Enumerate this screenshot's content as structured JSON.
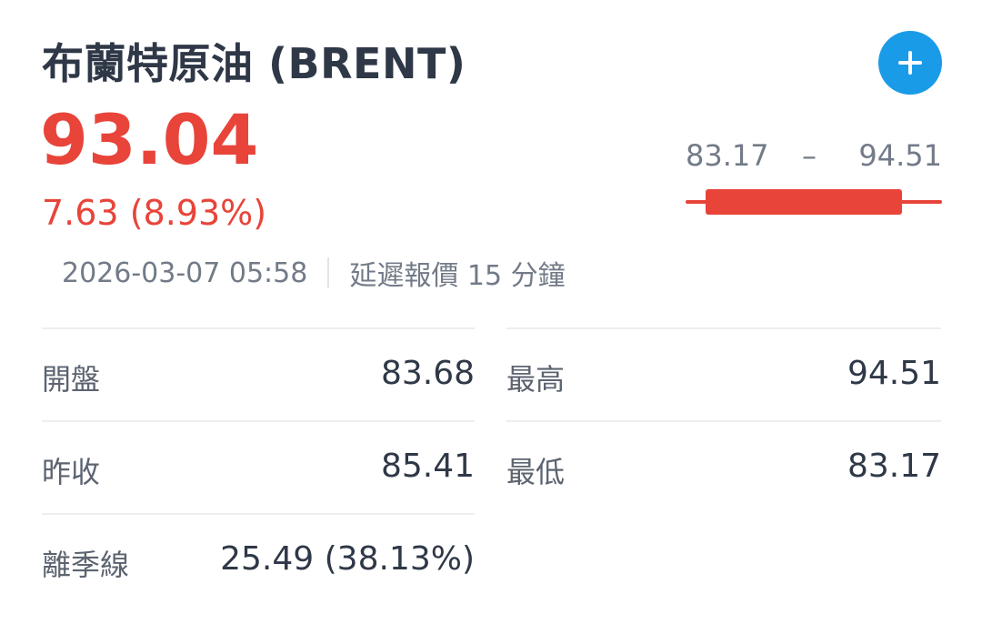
{
  "header": {
    "title": "布蘭特原油 (BRENT)",
    "add_icon": "plus-icon"
  },
  "quote": {
    "price": "93.04",
    "change": "7.63 (8.93%)",
    "timestamp": "2026-03-07 05:58",
    "delay_note": "延遲報價 15 分鐘"
  },
  "range": {
    "low": "83.17",
    "dash": "–",
    "high": "94.51",
    "low_value": 83.17,
    "high_value": 94.51,
    "open_value": 83.68,
    "current_value": 93.04
  },
  "stats": {
    "left": [
      {
        "label": "開盤",
        "value": "83.68"
      },
      {
        "label": "昨收",
        "value": "85.41"
      },
      {
        "label": "離季線",
        "value": "25.49 (38.13%)"
      }
    ],
    "right": [
      {
        "label": "最高",
        "value": "94.51"
      },
      {
        "label": "最低",
        "value": "83.17"
      }
    ]
  },
  "colors": {
    "up": "#e8443a",
    "accent": "#1a9be8",
    "text": "#2f3847",
    "muted": "#737b88"
  }
}
